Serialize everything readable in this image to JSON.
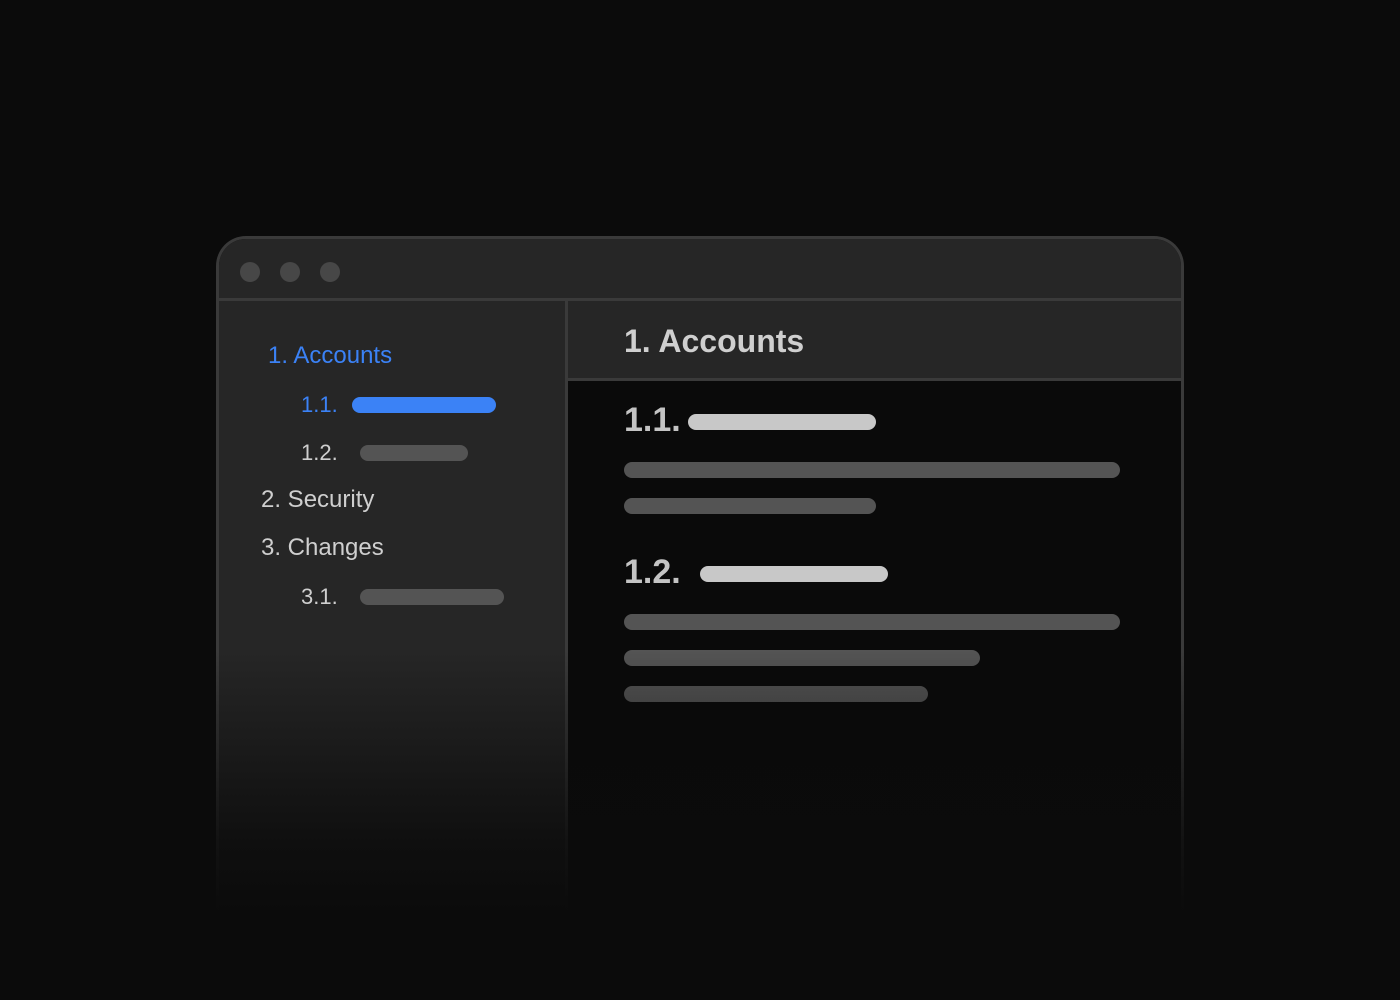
{
  "window": {
    "controls": [
      "close-dot",
      "minimize-dot",
      "zoom-dot"
    ]
  },
  "sidebar": {
    "items": [
      {
        "label": "1. Accounts",
        "active": true
      },
      {
        "label": "1.1.",
        "active": true
      },
      {
        "label": "1.2.",
        "active": false
      },
      {
        "label": "2. Security",
        "active": false
      },
      {
        "label": "3. Changes",
        "active": false
      },
      {
        "label": "3.1.",
        "active": false
      }
    ]
  },
  "main": {
    "title": "1. Accounts",
    "sections": [
      {
        "number": "1.1."
      },
      {
        "number": "1.2."
      }
    ]
  },
  "colors": {
    "accent": "#3b82f6",
    "background": "#0b0b0b",
    "panel": "#262626",
    "border": "#3a3a3a",
    "placeholder": "#545454",
    "placeholder_light": "#c8c8c8"
  }
}
